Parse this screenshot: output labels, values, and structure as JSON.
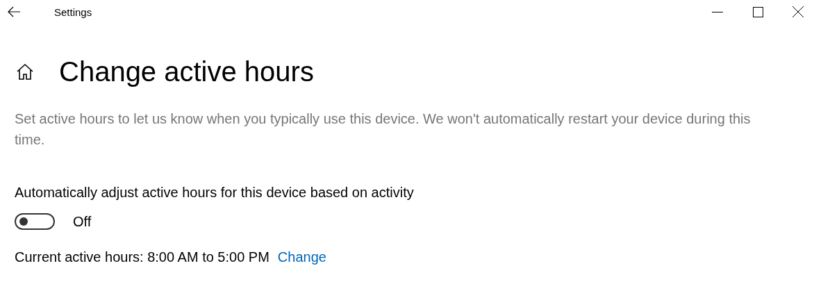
{
  "window": {
    "title": "Settings"
  },
  "page": {
    "heading": "Change active hours",
    "description": "Set active hours to let us know when you typically use this device. We won't automatically restart your device during this time."
  },
  "auto_adjust": {
    "label": "Automatically adjust active hours for this device based on activity",
    "on": false,
    "state_label": "Off"
  },
  "current_hours": {
    "text": "Current active hours: 8:00 AM to 5:00 PM",
    "link": "Change"
  }
}
